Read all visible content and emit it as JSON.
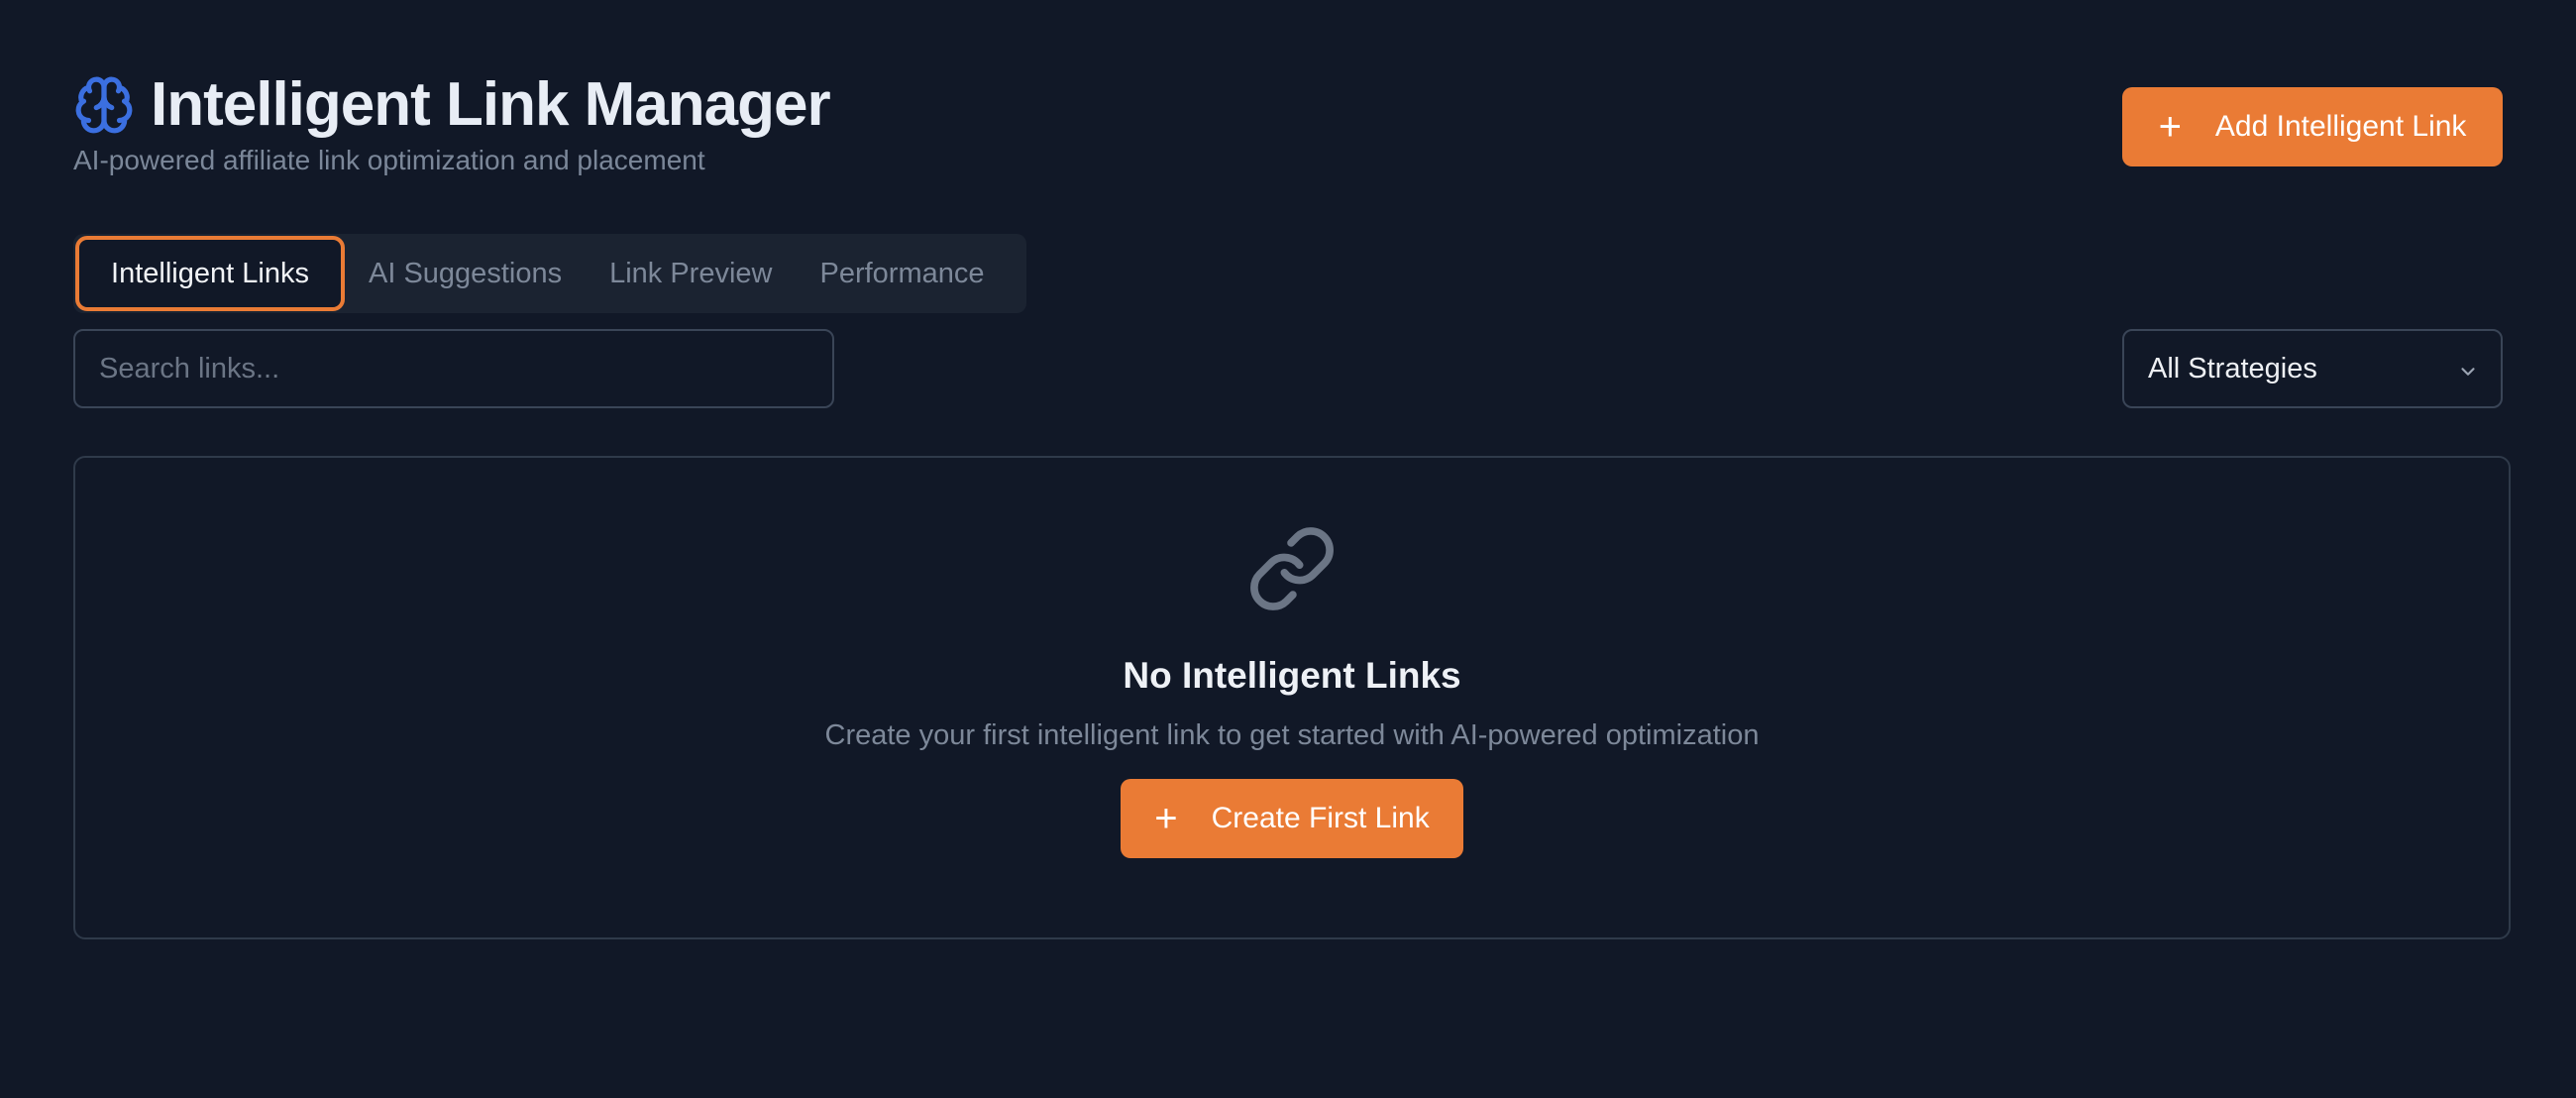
{
  "header": {
    "title": "Intelligent Link Manager",
    "subtitle": "AI-powered affiliate link optimization and placement",
    "add_button_label": "Add Intelligent Link",
    "icon": "brain-icon"
  },
  "tabs": [
    {
      "label": "Intelligent Links",
      "active": true
    },
    {
      "label": "AI Suggestions",
      "active": false
    },
    {
      "label": "Link Preview",
      "active": false
    },
    {
      "label": "Performance",
      "active": false
    }
  ],
  "search": {
    "placeholder": "Search links...",
    "value": ""
  },
  "filter": {
    "selected": "All Strategies"
  },
  "empty_state": {
    "icon": "link-icon",
    "title": "No Intelligent Links",
    "description": "Create your first intelligent link to get started with AI-powered optimization",
    "button_label": "Create First Link"
  },
  "colors": {
    "background": "#111827",
    "accent": "#ea7b35",
    "brain_icon": "#3b6fe0"
  }
}
